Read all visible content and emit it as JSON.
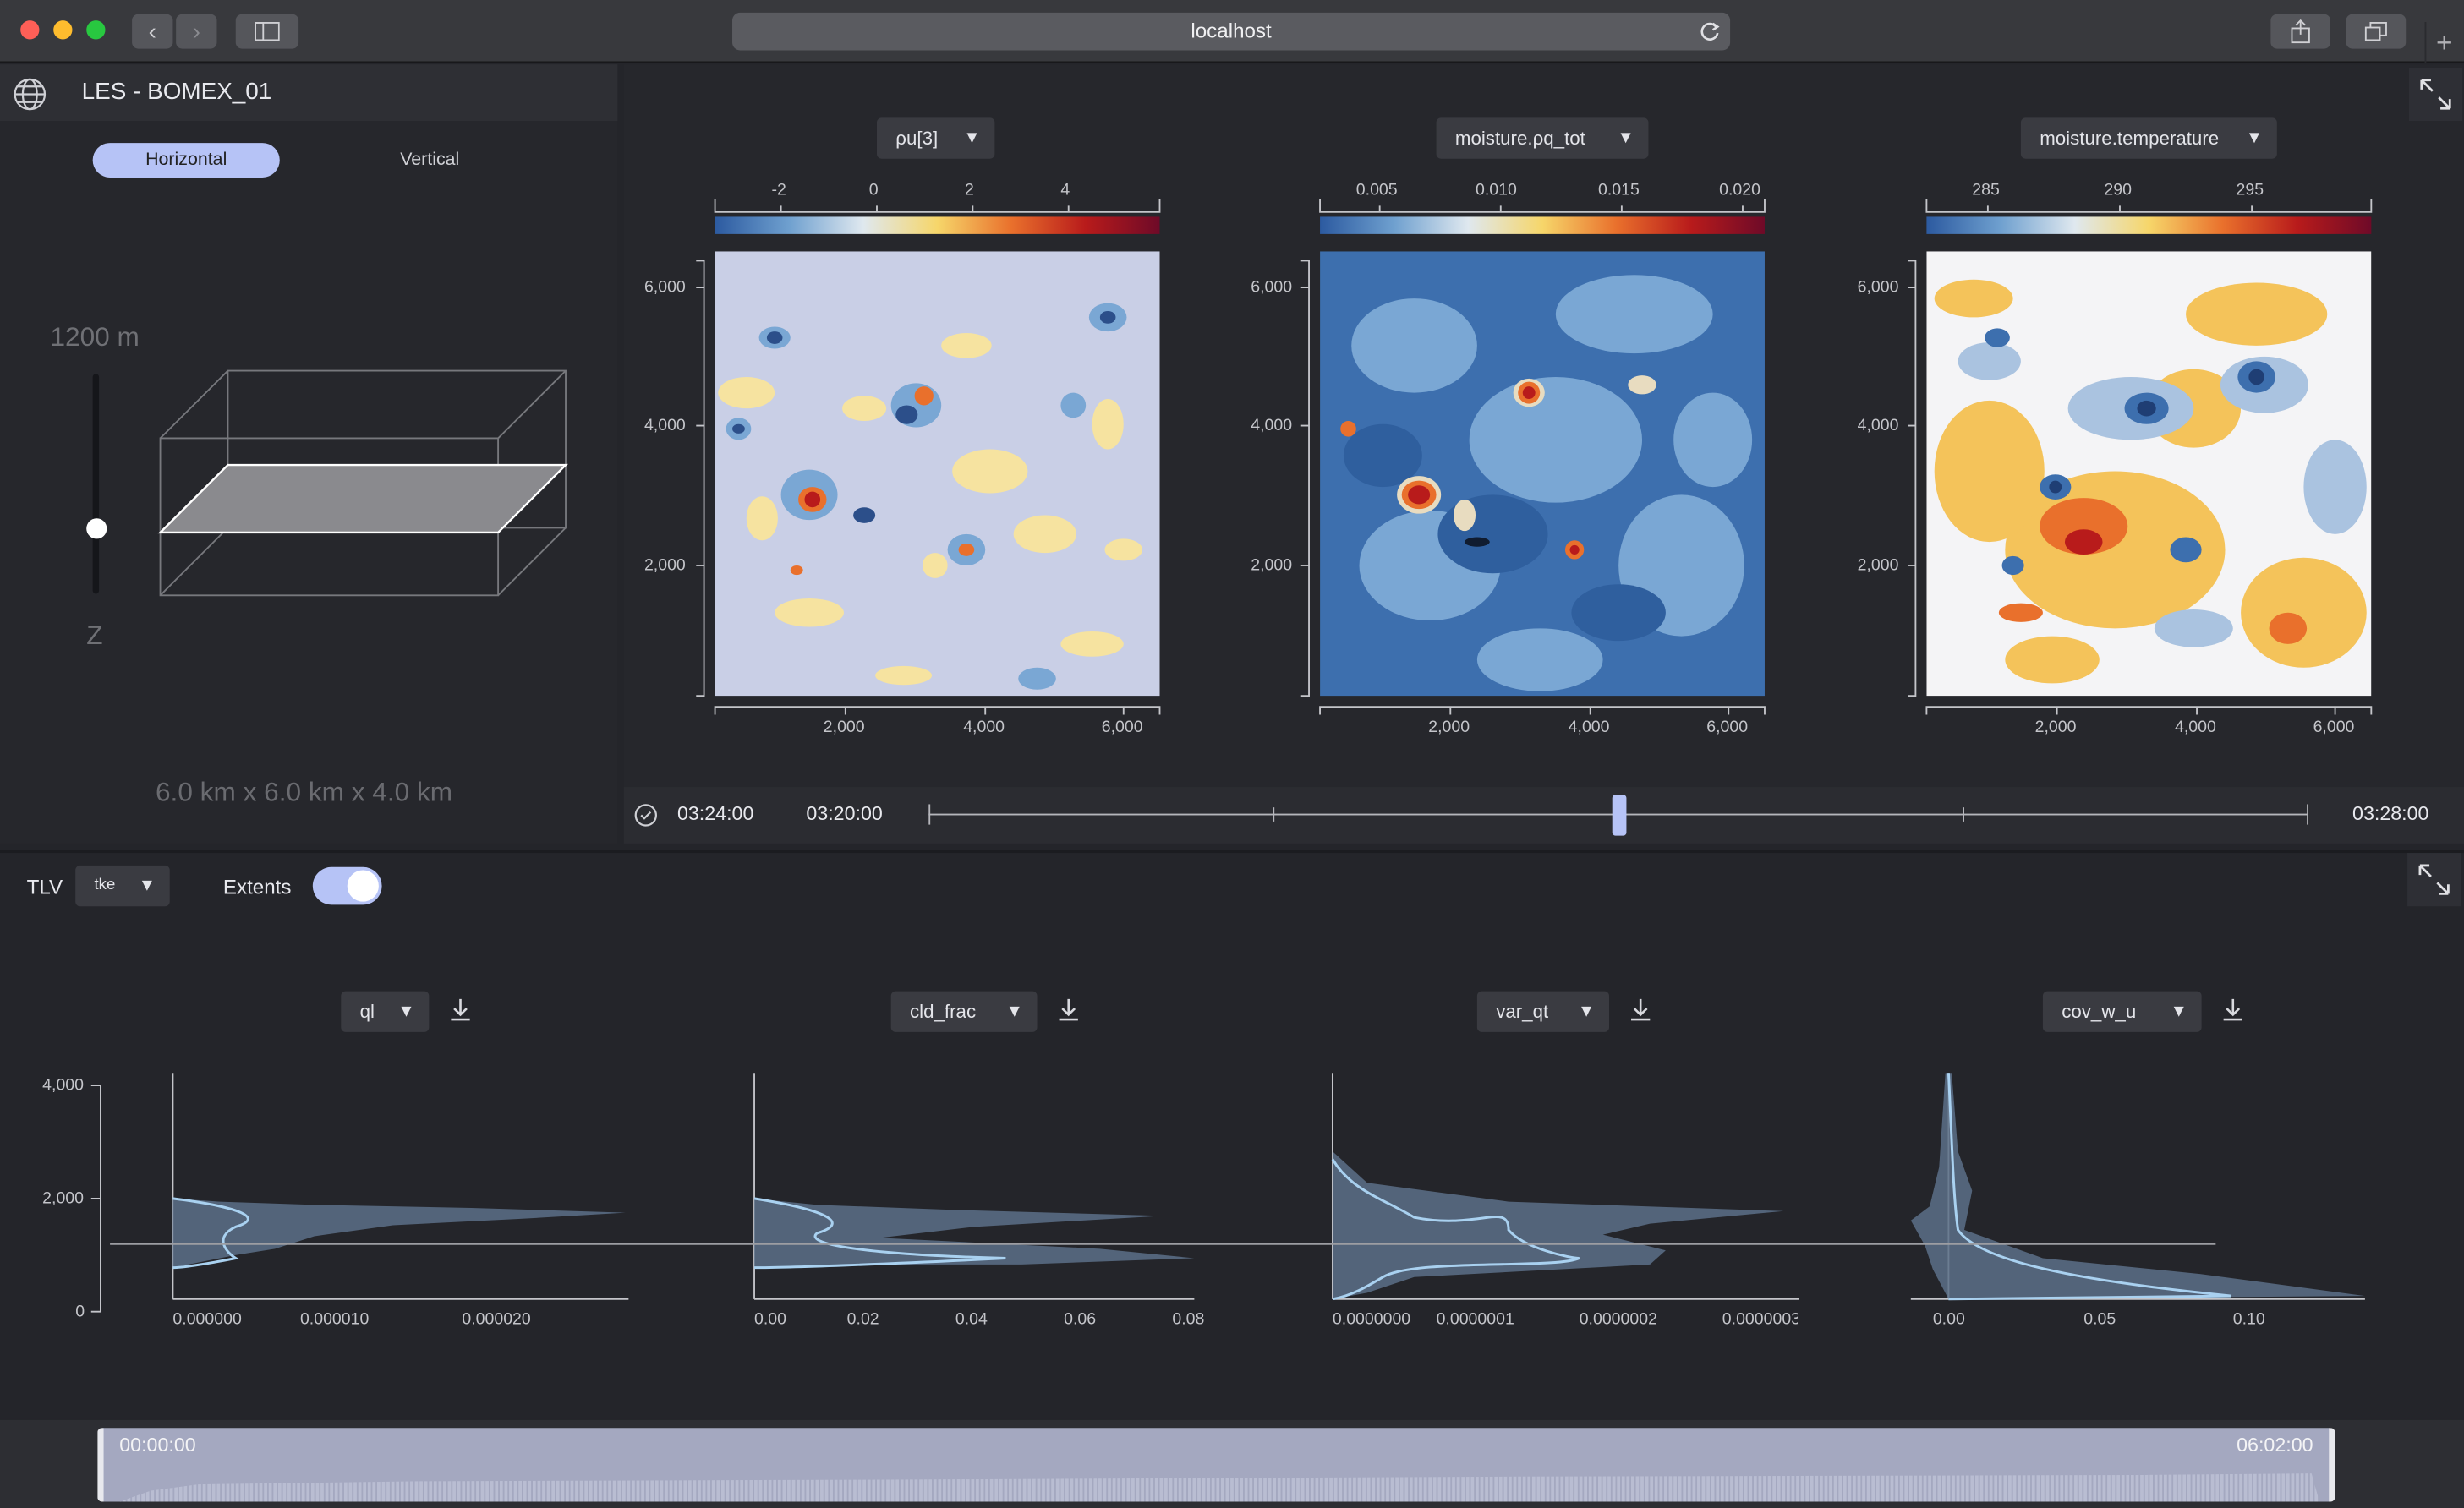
{
  "browser": {
    "url": "localhost"
  },
  "sidebar": {
    "title": "LES - BOMEX_01",
    "tabs": [
      "Horizontal",
      "Vertical"
    ],
    "active_tab": "Horizontal",
    "height_label": "1200 m",
    "z_label": "Z",
    "slider_fraction": 0.3,
    "domain_size": "6.0 km x 6.0 km x 4.0 km"
  },
  "maps": [
    {
      "variable": "ρu[3]",
      "colorbar_ticks": [
        "-2",
        "0",
        "2",
        "4"
      ]
    },
    {
      "variable": "moisture.ρq_tot",
      "colorbar_ticks": [
        "0.005",
        "0.010",
        "0.015",
        "0.020"
      ]
    },
    {
      "variable": "moisture.temperature",
      "colorbar_ticks": [
        "285",
        "290",
        "295"
      ]
    }
  ],
  "map_axes": {
    "y_ticks": [
      "6,000",
      "4,000",
      "2,000"
    ],
    "x_ticks": [
      "2,000",
      "4,000",
      "6,000"
    ]
  },
  "timeline": {
    "current": "03:24:00",
    "start": "03:20:00",
    "end": "03:28:00",
    "position_fraction": 0.5
  },
  "bottom": {
    "tlv_label": "TLV",
    "tlv_value": "tke",
    "extents_label": "Extents",
    "extents_on": true,
    "y_ticks": [
      "4,000",
      "2,000",
      "0"
    ],
    "profiles": [
      {
        "variable": "ql",
        "x_ticks": [
          "0.000000",
          "0.000010",
          "0.000020"
        ]
      },
      {
        "variable": "cld_frac",
        "x_ticks": [
          "0.00",
          "0.02",
          "0.04",
          "0.06",
          "0.08"
        ]
      },
      {
        "variable": "var_qt",
        "x_ticks": [
          "0.0000000",
          "0.0000001",
          "0.0000002",
          "0.0000003"
        ]
      },
      {
        "variable": "cov_w_u",
        "x_ticks": [
          "0.00",
          "0.05",
          "0.10"
        ]
      }
    ]
  },
  "footer": {
    "start": "00:00:00",
    "end": "06:02:00"
  },
  "colors": {
    "accent": "#b6c3f6",
    "profile_line": "#a9d1f0",
    "profile_fill": "#5c7088"
  },
  "icons": [
    "globe-icon",
    "expand-icon",
    "download-icon",
    "clock-icon",
    "reload-icon",
    "share-icon",
    "tabs-icon",
    "sidebar-icon",
    "back-icon",
    "forward-icon",
    "plus-icon"
  ]
}
